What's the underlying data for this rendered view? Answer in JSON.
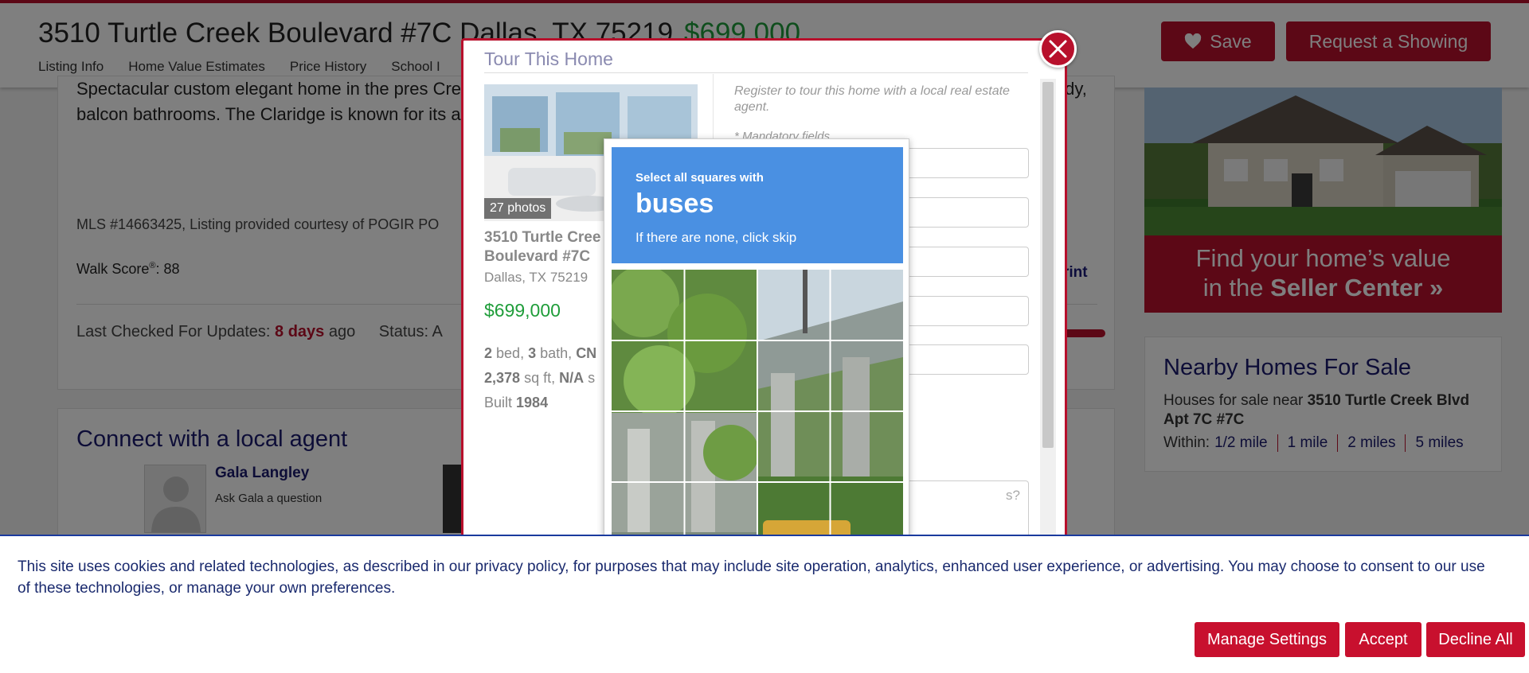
{
  "header": {
    "address": "3510 Turtle Creek Boulevard #7C Dallas, TX 75219",
    "price": "$699,000",
    "nav": [
      "Listing Info",
      "Home Value Estimates",
      "Price History",
      "School I"
    ],
    "save_label": "Save",
    "showing_label": "Request a Showing"
  },
  "main": {
    "description": "Spectacular custom elegant home in the pres Creek. Designed for living, intimate occasions spaces extra large dining room, study, balcon bathrooms. The Claridge is known for its ama court and dog park. An extraordinary opportur",
    "mls": "MLS #14663425, Listing provided courtesy of POGIR PO",
    "walk_label": "Walk Score",
    "walk_reg": "®",
    "walk_value": ": 88",
    "print_label": "rint",
    "updates_label": "Last Checked For Updates:",
    "updates_value": "8 days",
    "updates_suffix": "ago",
    "status_label": "Status: A"
  },
  "agent": {
    "heading": "Connect with a local agent",
    "name": "Gala Langley",
    "ask": "Ask Gala a question"
  },
  "sidebar": {
    "promo_line1": "Find your home’s value",
    "promo_line2_pre": "in the",
    "promo_line2_bold": "Seller Center »",
    "nearby_title": "Nearby Homes For Sale",
    "nearby_prefix": "Houses for sale near",
    "nearby_addr": "3510 Turtle Creek Blvd Apt 7C #7C",
    "within_label": "Within:",
    "within_options": [
      "1/2 mile",
      "1 mile",
      "2 miles",
      "5 miles"
    ]
  },
  "modal": {
    "title": "Tour This Home",
    "photos_badge": "27 photos",
    "address": "3510 Turtle Cree Boulevard #7C",
    "city": "Dallas, TX 75219",
    "price": "$699,000",
    "beds": "2",
    "beds_label": "bed,",
    "baths": "3",
    "baths_label": "bath,",
    "type": "CN",
    "sqft": "2,378",
    "sqft_label": "sq ft,",
    "lot": "N/A",
    "lot_label": "s",
    "built_label": "Built",
    "built": "1984",
    "register_text": "Register to tour this home with a local real estate agent.",
    "mandatory": "* Mandatory fields",
    "email_placeholder_fragment": "m",
    "question_fragment": "s?"
  },
  "captcha": {
    "instruction": "Select all squares with",
    "target": "buses",
    "sub": "If there are none, click skip"
  },
  "cookie": {
    "text": "This site uses cookies and related technologies, as described in our privacy policy, for purposes that may include site operation, analytics, enhanced user experience, or advertising. You may choose to consent to our use of these technologies, or manage your own preferences.",
    "manage": "Manage Settings",
    "accept": "Accept",
    "decline": "Decline All"
  },
  "colors": {
    "brand_red": "#b8102c",
    "price_green": "#1f9d3a",
    "navy": "#1a1a6e",
    "captcha_blue": "#4a90e2"
  },
  "icons": [
    "heart-icon",
    "close-icon",
    "avatar-placeholder-icon"
  ]
}
